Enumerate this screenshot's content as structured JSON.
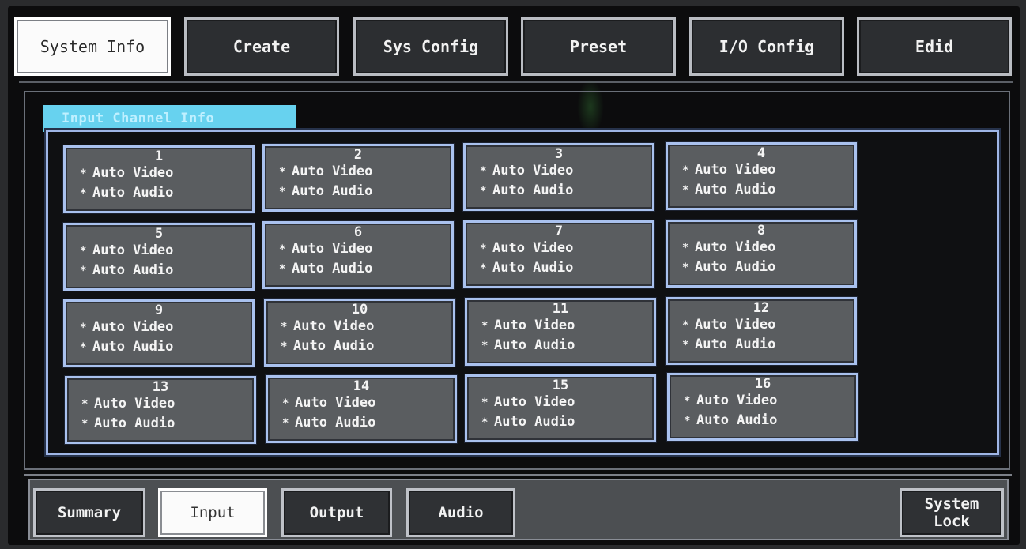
{
  "top_tabs": [
    {
      "label": "System Info",
      "active": true
    },
    {
      "label": "Create",
      "active": false
    },
    {
      "label": "Sys Config",
      "active": false
    },
    {
      "label": "Preset",
      "active": false
    },
    {
      "label": "I/O Config",
      "active": false
    },
    {
      "label": "Edid",
      "active": false
    }
  ],
  "panel": {
    "title": "Input Channel Info"
  },
  "channels": [
    {
      "num": "1",
      "video": "Auto Video",
      "audio": "Auto Audio"
    },
    {
      "num": "2",
      "video": "Auto Video",
      "audio": "Auto Audio"
    },
    {
      "num": "3",
      "video": "Auto Video",
      "audio": "Auto Audio"
    },
    {
      "num": "4",
      "video": "Auto Video",
      "audio": "Auto Audio"
    },
    {
      "num": "5",
      "video": "Auto Video",
      "audio": "Auto Audio"
    },
    {
      "num": "6",
      "video": "Auto Video",
      "audio": "Auto Audio"
    },
    {
      "num": "7",
      "video": "Auto Video",
      "audio": "Auto Audio"
    },
    {
      "num": "8",
      "video": "Auto Video",
      "audio": "Auto Audio"
    },
    {
      "num": "9",
      "video": "Auto Video",
      "audio": "Auto Audio"
    },
    {
      "num": "10",
      "video": "Auto Video",
      "audio": "Auto Audio"
    },
    {
      "num": "11",
      "video": "Auto Video",
      "audio": "Auto Audio"
    },
    {
      "num": "12",
      "video": "Auto Video",
      "audio": "Auto Audio"
    },
    {
      "num": "13",
      "video": "Auto Video",
      "audio": "Auto Audio"
    },
    {
      "num": "14",
      "video": "Auto Video",
      "audio": "Auto Audio"
    },
    {
      "num": "15",
      "video": "Auto Video",
      "audio": "Auto Audio"
    },
    {
      "num": "16",
      "video": "Auto Video",
      "audio": "Auto Audio"
    }
  ],
  "bullet_glyph": "*",
  "bottom_tabs": [
    {
      "label": "Summary",
      "active": false
    },
    {
      "label": "Input",
      "active": true
    },
    {
      "label": "Output",
      "active": false
    },
    {
      "label": "Audio",
      "active": false
    }
  ],
  "system_lock": {
    "line1": "System",
    "line2": "Lock"
  },
  "colors": {
    "accent_tab": "#67d2ef",
    "card_border": "#a9c1ee",
    "card_fill": "#5a5d60",
    "active_tab": "#fbfbfb"
  }
}
